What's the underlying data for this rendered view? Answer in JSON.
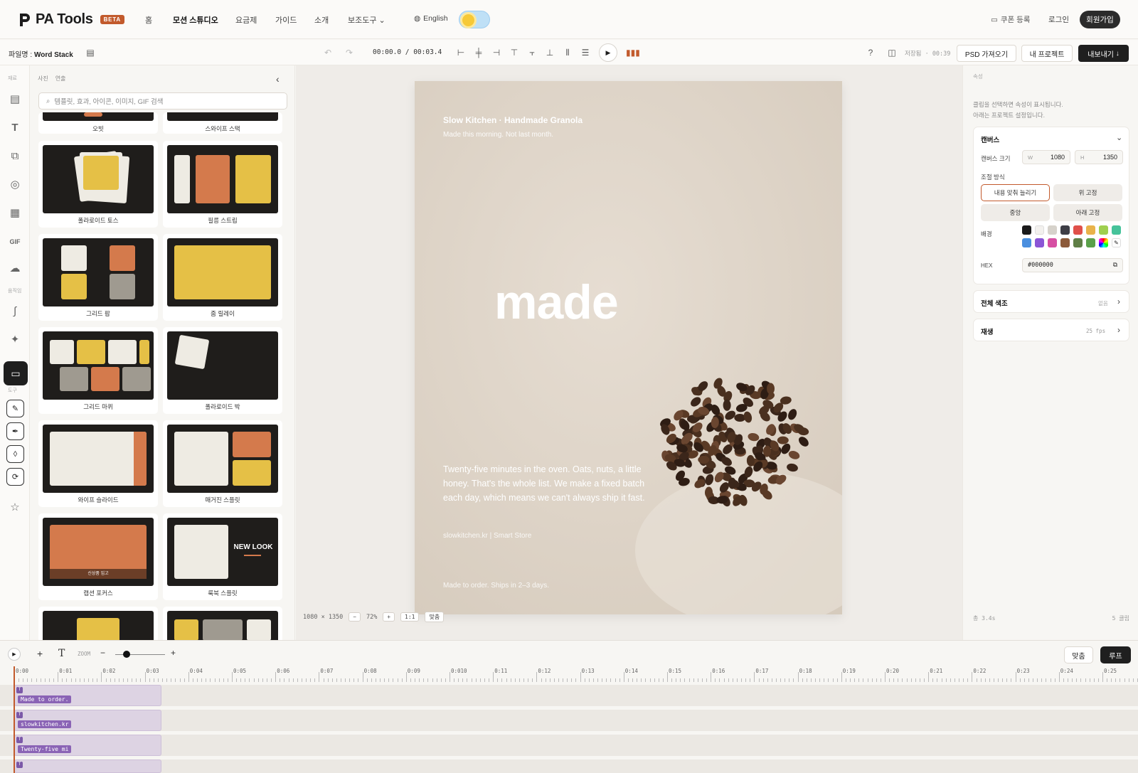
{
  "app": {
    "name": "PA Tools",
    "badge": "BETA"
  },
  "nav": {
    "items": [
      "홈",
      "모션 스튜디오",
      "요금제",
      "가이드",
      "소개",
      "보조도구"
    ],
    "active": "모션 스튜디오",
    "language": "English"
  },
  "account": {
    "coupon": "쿠폰 등록",
    "login": "로그인",
    "signup": "회원가입"
  },
  "toolbar": {
    "filename_label": "파일명 :",
    "filename": "Word Stack",
    "timecode": "00:00.0 / 00:03.4",
    "saved": "저장됨 · 00:39",
    "psd": "PSD 가져오기",
    "projects": "내 프로젝트",
    "export": "내보내기"
  },
  "rail": {
    "group1": "재료",
    "group2": "움직임",
    "group3": "도구"
  },
  "panel": {
    "tabs": [
      "사진",
      "연출"
    ],
    "search_placeholder": "템플릿, 효과, 아이콘, 이미지, GIF 검색",
    "partial_top": [
      "오빗",
      "스와이프 스택"
    ],
    "cards": [
      "폴라로이드 토스",
      "필름 스트립",
      "그리드 팝",
      "줌 릴레이",
      "그리드 마퀴",
      "폴라로이드 박",
      "와이프 슬라이드",
      "매거진 스플릿",
      "캡션 포커스",
      "룩북 스플릿"
    ],
    "caption_focus_text": "신상품 입고",
    "lookbook_text": "NEW LOOK"
  },
  "canvas": {
    "title": "Slow Kitchen · Handmade Granola",
    "subtitle": "Made this morning. Not last month.",
    "headline": "made",
    "body": "Twenty-five minutes in the oven. Oats, nuts, a little honey. That's the whole list. We make a fixed batch each day, which means we can't always ship it fast.",
    "url": "slowkitchen.kr  |  Smart Store",
    "footer": "Made to order. Ships in 2–3 days."
  },
  "stage": {
    "size": "1080 × 1350",
    "zoom": "72%",
    "ratio": "1:1",
    "fit": "맞춤"
  },
  "props": {
    "header": "속성",
    "hint1": "클립을 선택하면 속성이 표시됩니다.",
    "hint2": "아래는 프로젝트 설정입니다.",
    "canvas_section": "캔버스",
    "canvas_size_label": "캔버스 크기",
    "w_label": "W",
    "w": "1080",
    "h_label": "H",
    "h": "1350",
    "fit_label": "조절 방식",
    "fit_options": [
      "내용 맞춰 늘리기",
      "위 고정",
      "중앙",
      "아래 고정"
    ],
    "fit_selected": "내용 맞춰 늘리기",
    "bg_label": "배경",
    "swatches": [
      "#1a1a1a",
      "#f3f1ee",
      "#d6d2cb",
      "#3e3e46",
      "#e0504a",
      "#e9b34a",
      "#9fcf4f",
      "#46c39a",
      "#4a8fdf",
      "#8b55d6",
      "#d64fa3",
      "#8c5a3a",
      "#5f7f46",
      "#5aa04a"
    ],
    "hex_label": "HEX",
    "hex": "#000000",
    "grading": "전체 색조",
    "grading_value": "없음",
    "playback": "재생",
    "playback_value": "25 fps",
    "total": "총 3.4s",
    "clips": "5 클립"
  },
  "timeline": {
    "zoom_label": "ZOOM",
    "fit": "맞춤",
    "loop": "루프",
    "ticks": [
      "0:00",
      "0:01",
      "0:02",
      "0:03",
      "0:04",
      "0:05",
      "0:06",
      "0:07",
      "0:08",
      "0:09",
      "0:010",
      "0:11",
      "0:12",
      "0:13",
      "0:14",
      "0:15",
      "0:16",
      "0:17",
      "0:18",
      "0:19",
      "0:20",
      "0:21",
      "0:22",
      "0:23",
      "0:24",
      "0:25"
    ],
    "clips": [
      "Made to order.",
      "slowkitchen.kr",
      "Twenty-five mi"
    ]
  }
}
